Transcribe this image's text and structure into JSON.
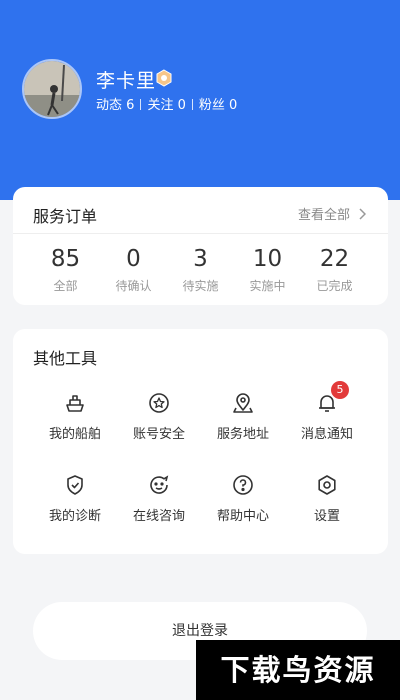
{
  "profile": {
    "name": "李卡里",
    "stats": [
      {
        "label": "动态",
        "value": "6"
      },
      {
        "label": "关注",
        "value": "0"
      },
      {
        "label": "粉丝",
        "value": "0"
      }
    ]
  },
  "orders": {
    "title": "服务订单",
    "view_all": "查看全部",
    "items": [
      {
        "value": "85",
        "label": "全部"
      },
      {
        "value": "0",
        "label": "待确认"
      },
      {
        "value": "3",
        "label": "待实施"
      },
      {
        "value": "10",
        "label": "实施中"
      },
      {
        "value": "22",
        "label": "已完成"
      }
    ]
  },
  "tools": {
    "title": "其他工具",
    "items": [
      {
        "label": "我的船舶",
        "icon": "ship-icon"
      },
      {
        "label": "账号安全",
        "icon": "shield-star-icon"
      },
      {
        "label": "服务地址",
        "icon": "location-pin-icon"
      },
      {
        "label": "消息通知",
        "icon": "bell-icon",
        "badge": "5"
      },
      {
        "label": "我的诊断",
        "icon": "shield-check-icon"
      },
      {
        "label": "在线咨询",
        "icon": "chat-face-icon"
      },
      {
        "label": "帮助中心",
        "icon": "help-circle-icon"
      },
      {
        "label": "设置",
        "icon": "settings-hex-icon"
      }
    ]
  },
  "logout_label": "退出登录",
  "watermark": "下载鸟资源",
  "colors": {
    "header": "#2f72ee",
    "badge": "#e23a3a",
    "background": "#f4f5f7"
  }
}
